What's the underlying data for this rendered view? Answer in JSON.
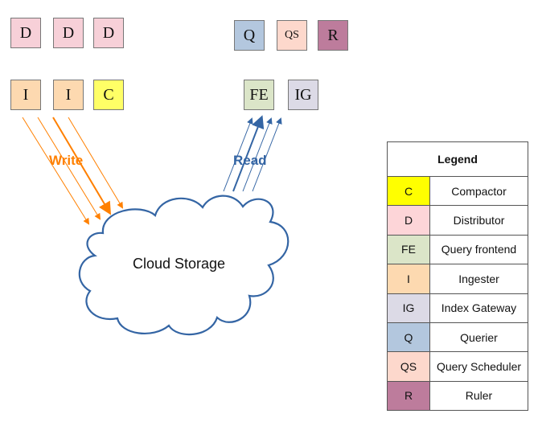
{
  "components": {
    "top_left": [
      {
        "code": "D",
        "color": "#f7d0d8"
      },
      {
        "code": "D",
        "color": "#f7d0d8"
      },
      {
        "code": "D",
        "color": "#f7d0d8"
      }
    ],
    "bottom_left": [
      {
        "code": "I",
        "color": "#fdd9b0"
      },
      {
        "code": "I",
        "color": "#fdd9b0"
      },
      {
        "code": "C",
        "color": "#ffff66"
      }
    ],
    "top_right": [
      {
        "code": "Q",
        "color": "#b3c7de"
      },
      {
        "code": "QS",
        "color": "#fdd8cc"
      },
      {
        "code": "R",
        "color": "#bd7c9c"
      }
    ],
    "bottom_right": [
      {
        "code": "FE",
        "color": "#dbe5c8"
      },
      {
        "code": "IG",
        "color": "#dcdae6"
      }
    ]
  },
  "flows": {
    "write_label": "Write",
    "write_color": "#ff8000",
    "read_label": "Read",
    "read_color": "#3465a4"
  },
  "cloud": {
    "label": "Cloud Storage",
    "stroke": "#3465a4"
  },
  "legend": {
    "title": "Legend",
    "items": [
      {
        "code": "C",
        "name": "Compactor",
        "color": "#ffff00"
      },
      {
        "code": "D",
        "name": "Distributor",
        "color": "#fdd5d8"
      },
      {
        "code": "FE",
        "name": "Query frontend",
        "color": "#dbe5c8"
      },
      {
        "code": "I",
        "name": "Ingester",
        "color": "#fdd9b0"
      },
      {
        "code": "IG",
        "name": "Index Gateway",
        "color": "#dcdae6"
      },
      {
        "code": "Q",
        "name": "Querier",
        "color": "#b3c7de"
      },
      {
        "code": "QS",
        "name": "Query Scheduler",
        "color": "#fdd8cc"
      },
      {
        "code": "R",
        "name": "Ruler",
        "color": "#bd7c9c"
      }
    ]
  }
}
